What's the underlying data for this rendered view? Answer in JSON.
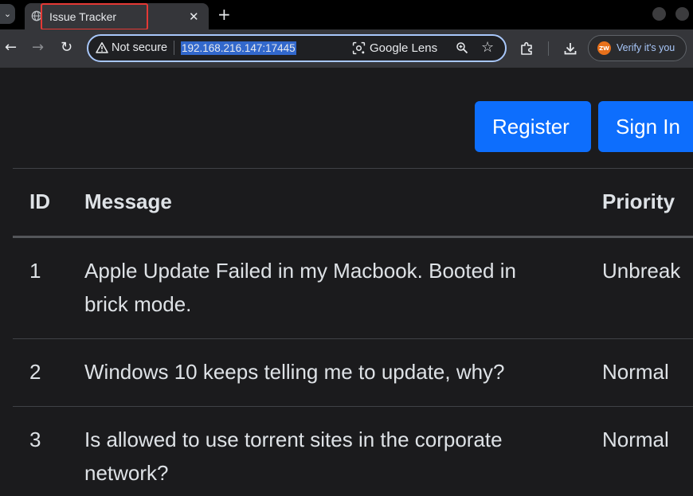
{
  "browser": {
    "tab_list_glyph": "⌄",
    "tab_title": "Issue Tracker",
    "tab_close": "✕",
    "new_tab": "+",
    "nav": {
      "back": "←",
      "forward": "→",
      "reload": "↻"
    },
    "omnibox": {
      "security_label": "Not secure",
      "url": "192.168.216.147:17445",
      "lens_label": "Google Lens",
      "star": "☆"
    },
    "profile": {
      "avatar_text": "ZW",
      "verify_label": "Verify it's you"
    }
  },
  "page": {
    "register_label": "Register",
    "signin_label": "Sign In",
    "table": {
      "headers": {
        "id": "ID",
        "message": "Message",
        "priority": "Priority"
      },
      "rows": [
        {
          "id": "1",
          "message_line1": "Apple Update Failed in my Macbook. Booted in",
          "message_line2": "brick mode.",
          "priority": "Unbreak"
        },
        {
          "id": "2",
          "message_line1": "Windows 10 keeps telling me to update, why?",
          "message_line2": "",
          "priority": "Normal"
        },
        {
          "id": "3",
          "message_line1": "Is allowed to use torrent sites in the corporate",
          "message_line2": "network?",
          "priority": "Normal"
        }
      ]
    }
  },
  "colors": {
    "primary": "#0d6efd",
    "background": "#1b1b1d",
    "highlight_box": "#e53935"
  }
}
